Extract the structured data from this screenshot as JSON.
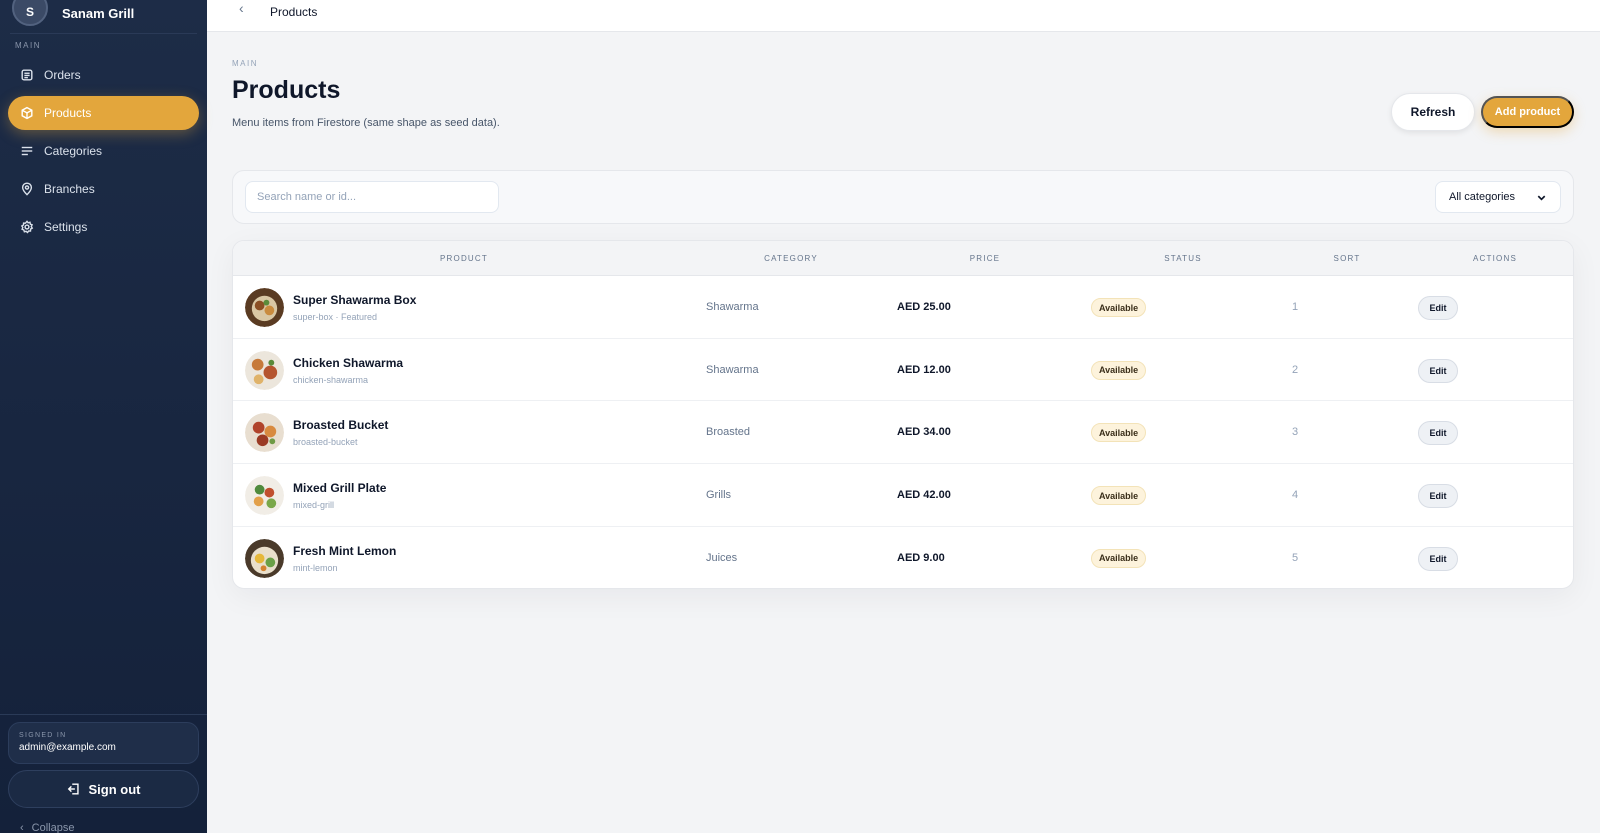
{
  "brand": {
    "initial": "S",
    "name": "Sanam Grill"
  },
  "sidebar": {
    "section_label": "MAIN",
    "items": [
      {
        "label": "Orders",
        "icon": "orders-icon"
      },
      {
        "label": "Products",
        "icon": "box-icon",
        "active": true
      },
      {
        "label": "Categories",
        "icon": "list-icon"
      },
      {
        "label": "Branches",
        "icon": "location-pin-icon"
      },
      {
        "label": "Settings",
        "icon": "gear-icon"
      }
    ],
    "signed_in_label": "SIGNED IN",
    "signed_in_email": "admin@example.com",
    "sign_out_label": "Sign out",
    "collapse_label": "Collapse"
  },
  "topbar": {
    "title": "Products"
  },
  "page": {
    "section_label": "MAIN",
    "title": "Products",
    "subtitle": "Menu items from Firestore (same shape as seed data).",
    "refresh_label": "Refresh",
    "add_label": "Add product"
  },
  "filters": {
    "search_placeholder": "Search name or id...",
    "category_selected": "All categories"
  },
  "table": {
    "columns": [
      "PRODUCT",
      "CATEGORY",
      "PRICE",
      "STATUS",
      "SORT",
      "ACTIONS"
    ],
    "rows": [
      {
        "name": "Super Shawarma Box",
        "sub": "super-box · Featured",
        "category": "Shawarma",
        "price": "AED 25.00",
        "status": "Available",
        "sort": "1",
        "action": "Edit"
      },
      {
        "name": "Chicken Shawarma",
        "sub": "chicken-shawarma",
        "category": "Shawarma",
        "price": "AED 12.00",
        "status": "Available",
        "sort": "2",
        "action": "Edit"
      },
      {
        "name": "Broasted Bucket",
        "sub": "broasted-bucket",
        "category": "Broasted",
        "price": "AED 34.00",
        "status": "Available",
        "sort": "3",
        "action": "Edit"
      },
      {
        "name": "Mixed Grill Plate",
        "sub": "mixed-grill",
        "category": "Grills",
        "price": "AED 42.00",
        "status": "Available",
        "sort": "4",
        "action": "Edit"
      },
      {
        "name": "Fresh Mint Lemon",
        "sub": "mint-lemon",
        "category": "Juices",
        "price": "AED 9.00",
        "status": "Available",
        "sort": "5",
        "action": "Edit"
      }
    ]
  },
  "colors": {
    "accent": "#e3a63c",
    "sidebar_bg": "#1b2a44",
    "badge_bg": "#fdf3dc"
  }
}
